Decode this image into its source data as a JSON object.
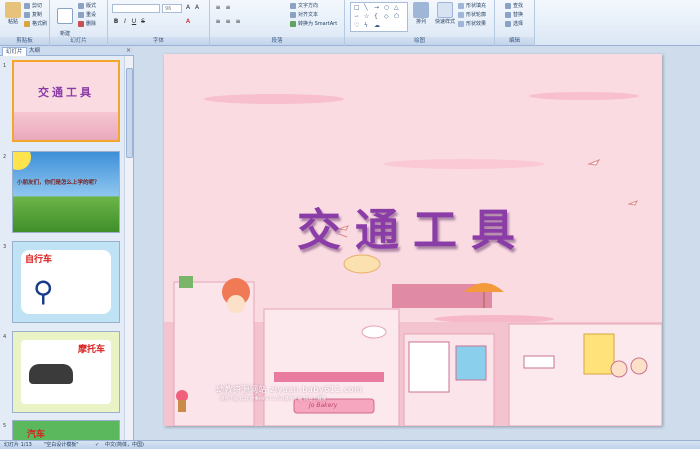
{
  "ribbon": {
    "clipboard": {
      "paste": "粘贴",
      "cut": "剪切",
      "copy": "复制",
      "format_painter": "格式刷",
      "label": "剪贴板"
    },
    "slides": {
      "new_slide": "新建\n幻灯片",
      "layout": "版式",
      "reset": "重设",
      "delete": "删除",
      "label": "幻灯片"
    },
    "font": {
      "font_size": "96",
      "label": "字体"
    },
    "paragraph": {
      "text_direction": "文字方向",
      "align_text": "对齐文本",
      "smartart": "转换为 SmartArt",
      "label": "段落"
    },
    "drawing": {
      "arrange": "排列",
      "quick_styles": "快速样式",
      "shape_fill": "形状填充",
      "shape_outline": "形状轮廓",
      "shape_effects": "形状效果",
      "label": "绘图"
    },
    "editing": {
      "find": "查找",
      "replace": "替换",
      "select": "选择",
      "label": "编辑"
    }
  },
  "pane": {
    "tabs": [
      "幻灯片",
      "大纲"
    ],
    "close": "×",
    "thumbnails": [
      {
        "num": "1",
        "title": "交通工具"
      },
      {
        "num": "2",
        "title": "小朋友们，你们是怎么上学的呢？"
      },
      {
        "num": "3",
        "title": "自行车"
      },
      {
        "num": "4",
        "title": "摩托车"
      },
      {
        "num": "5",
        "title": "汽车"
      }
    ]
  },
  "slide": {
    "title": "交通工具",
    "watermark": "幼教资源网站  ziyuan.baby611.com",
    "watermark_sub": "课件下载   儿歌   故事MP3   FLASH课件下载   试卷下载库",
    "sign": "Jo Bakery"
  },
  "status": {
    "slide_info": "幻灯片 1/13",
    "theme": "\"空白设计模板\"",
    "language": "中文(简体，中国)"
  },
  "colors": {
    "title": "#8a3ca7",
    "slide_bg": "#fadbe2",
    "selected": "#f4a62a"
  }
}
